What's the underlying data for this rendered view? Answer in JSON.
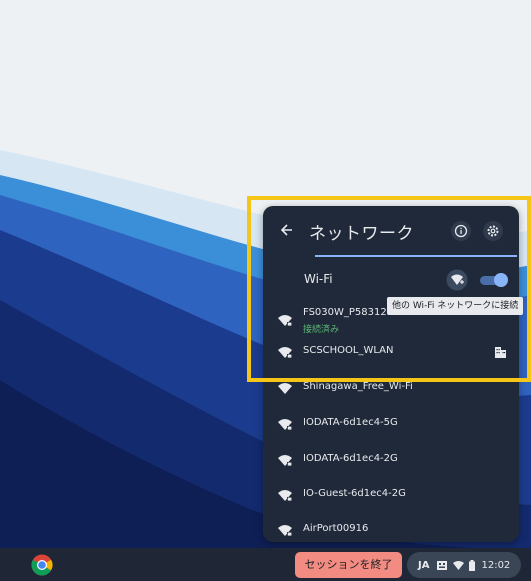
{
  "panel": {
    "title": "ネットワーク",
    "back_icon": "arrow-left-icon",
    "info_icon": "info-icon",
    "settings_icon": "gear-icon"
  },
  "wifi": {
    "label": "Wi-Fi",
    "enabled": true,
    "join_icon": "wifi-add-icon",
    "tooltip": "他の Wi-Fi ネットワークに接続"
  },
  "networks": [
    {
      "name": "FS030W_P58312",
      "status": "接続済み"
    },
    {
      "name": "SCSCHOOL_WLAN",
      "status": ""
    },
    {
      "name": "Shinagawa_Free_Wi-Fi",
      "status": ""
    },
    {
      "name": "IODATA-6d1ec4-5G",
      "status": ""
    },
    {
      "name": "IODATA-6d1ec4-2G",
      "status": ""
    },
    {
      "name": "IO-Guest-6d1ec4-2G",
      "status": ""
    },
    {
      "name": "AirPort00916",
      "status": ""
    }
  ],
  "shelf": {
    "end_session": "セッションを終了",
    "ime": "JA",
    "time": "12:02"
  },
  "colors": {
    "accent": "#8ab4f8",
    "connected": "#5bb974",
    "highlight": "#f5c518",
    "end_session_bg": "#f28b82"
  }
}
